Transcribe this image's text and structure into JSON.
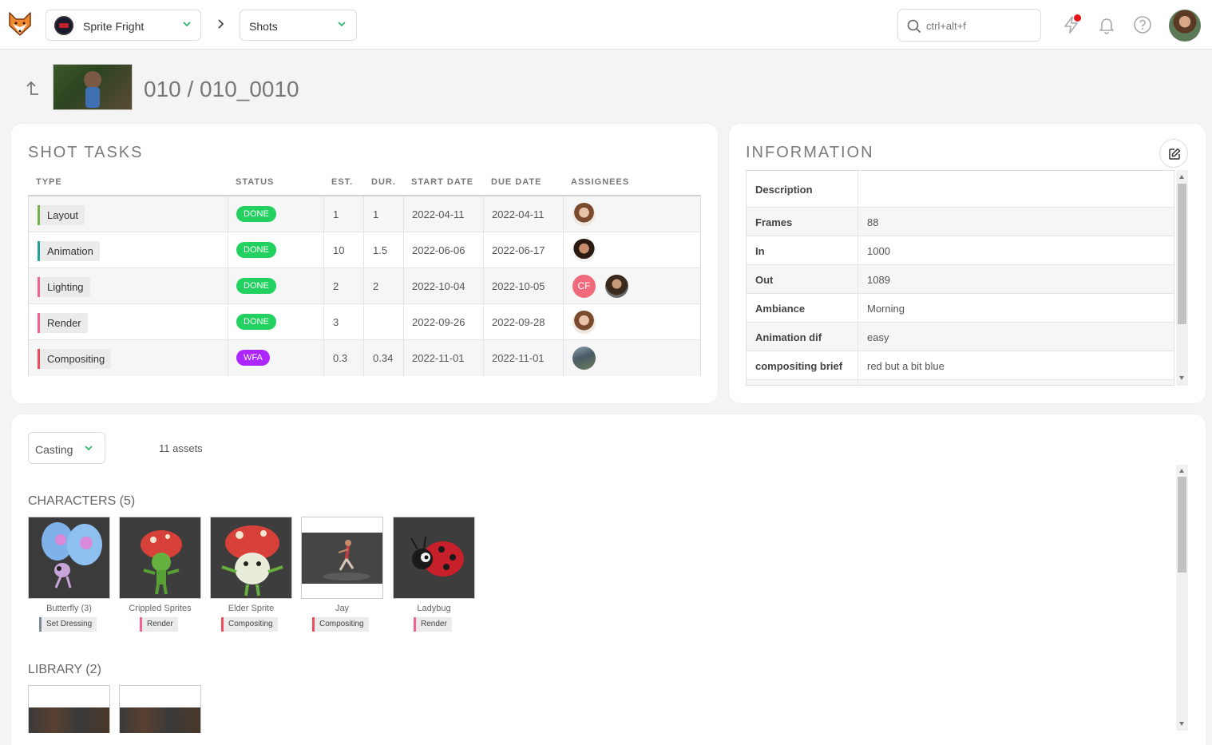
{
  "topbar": {
    "project_name": "Sprite Fright",
    "section_name": "Shots",
    "search_placeholder": "ctrl+alt+f"
  },
  "header": {
    "title": "010 / 010_0010"
  },
  "tasks_card": {
    "title": "SHOT TASKS",
    "columns": [
      "TYPE",
      "STATUS",
      "EST.",
      "DUR.",
      "START DATE",
      "DUE DATE",
      "ASSIGNEES"
    ],
    "rows": [
      {
        "type": "Layout",
        "type_color": "#75b34a",
        "status": "DONE",
        "status_color": "#22d160",
        "est": "1",
        "dur": "1",
        "start": "2022-04-11",
        "due": "2022-04-11",
        "assignees": [
          {
            "initials": ""
          }
        ]
      },
      {
        "type": "Animation",
        "type_color": "#22a39a",
        "status": "DONE",
        "status_color": "#22d160",
        "est": "10",
        "dur": "1.5",
        "start": "2022-06-06",
        "due": "2022-06-17",
        "assignees": [
          {
            "initials": ""
          }
        ]
      },
      {
        "type": "Lighting",
        "type_color": "#f06292",
        "status": "DONE",
        "status_color": "#22d160",
        "est": "2",
        "dur": "2",
        "start": "2022-10-04",
        "due": "2022-10-05",
        "assignees": [
          {
            "initials": "CF"
          },
          {
            "initials": ""
          }
        ]
      },
      {
        "type": "Render",
        "type_color": "#f06292",
        "status": "DONE",
        "status_color": "#22d160",
        "est": "3",
        "dur": "",
        "start": "2022-09-26",
        "due": "2022-09-28",
        "assignees": [
          {
            "initials": ""
          }
        ]
      },
      {
        "type": "Compositing",
        "type_color": "#ee4b5f",
        "status": "WFA",
        "status_color": "#ab26ff",
        "est": "0.3",
        "dur": "0.34",
        "start": "2022-11-01",
        "due": "2022-11-01",
        "assignees": [
          {
            "initials": ""
          }
        ]
      }
    ]
  },
  "info_card": {
    "title": "INFORMATION",
    "rows": [
      {
        "key": "Description",
        "value": ""
      },
      {
        "key": "Frames",
        "value": "88"
      },
      {
        "key": "In",
        "value": "1000"
      },
      {
        "key": "Out",
        "value": "1089"
      },
      {
        "key": "Ambiance",
        "value": "Morning"
      },
      {
        "key": "Animation dif",
        "value": "easy"
      },
      {
        "key": "compositing brief",
        "value": "red but a bit blue"
      }
    ]
  },
  "casting": {
    "select_label": "Casting",
    "asset_count": "11 assets",
    "groups": [
      {
        "title": "CHARACTERS (5)",
        "assets": [
          {
            "name": "Butterfly (3)",
            "task": "Set Dressing",
            "task_color": "#7a8a94"
          },
          {
            "name": "Crippled Sprites",
            "task": "Render",
            "task_color": "#f06292"
          },
          {
            "name": "Elder Sprite",
            "task": "Compositing",
            "task_color": "#ee4b5f"
          },
          {
            "name": "Jay",
            "task": "Compositing",
            "task_color": "#ee4b5f"
          },
          {
            "name": "Ladybug",
            "task": "Render",
            "task_color": "#f06292"
          }
        ]
      },
      {
        "title": "LIBRARY (2)",
        "assets": []
      }
    ]
  }
}
